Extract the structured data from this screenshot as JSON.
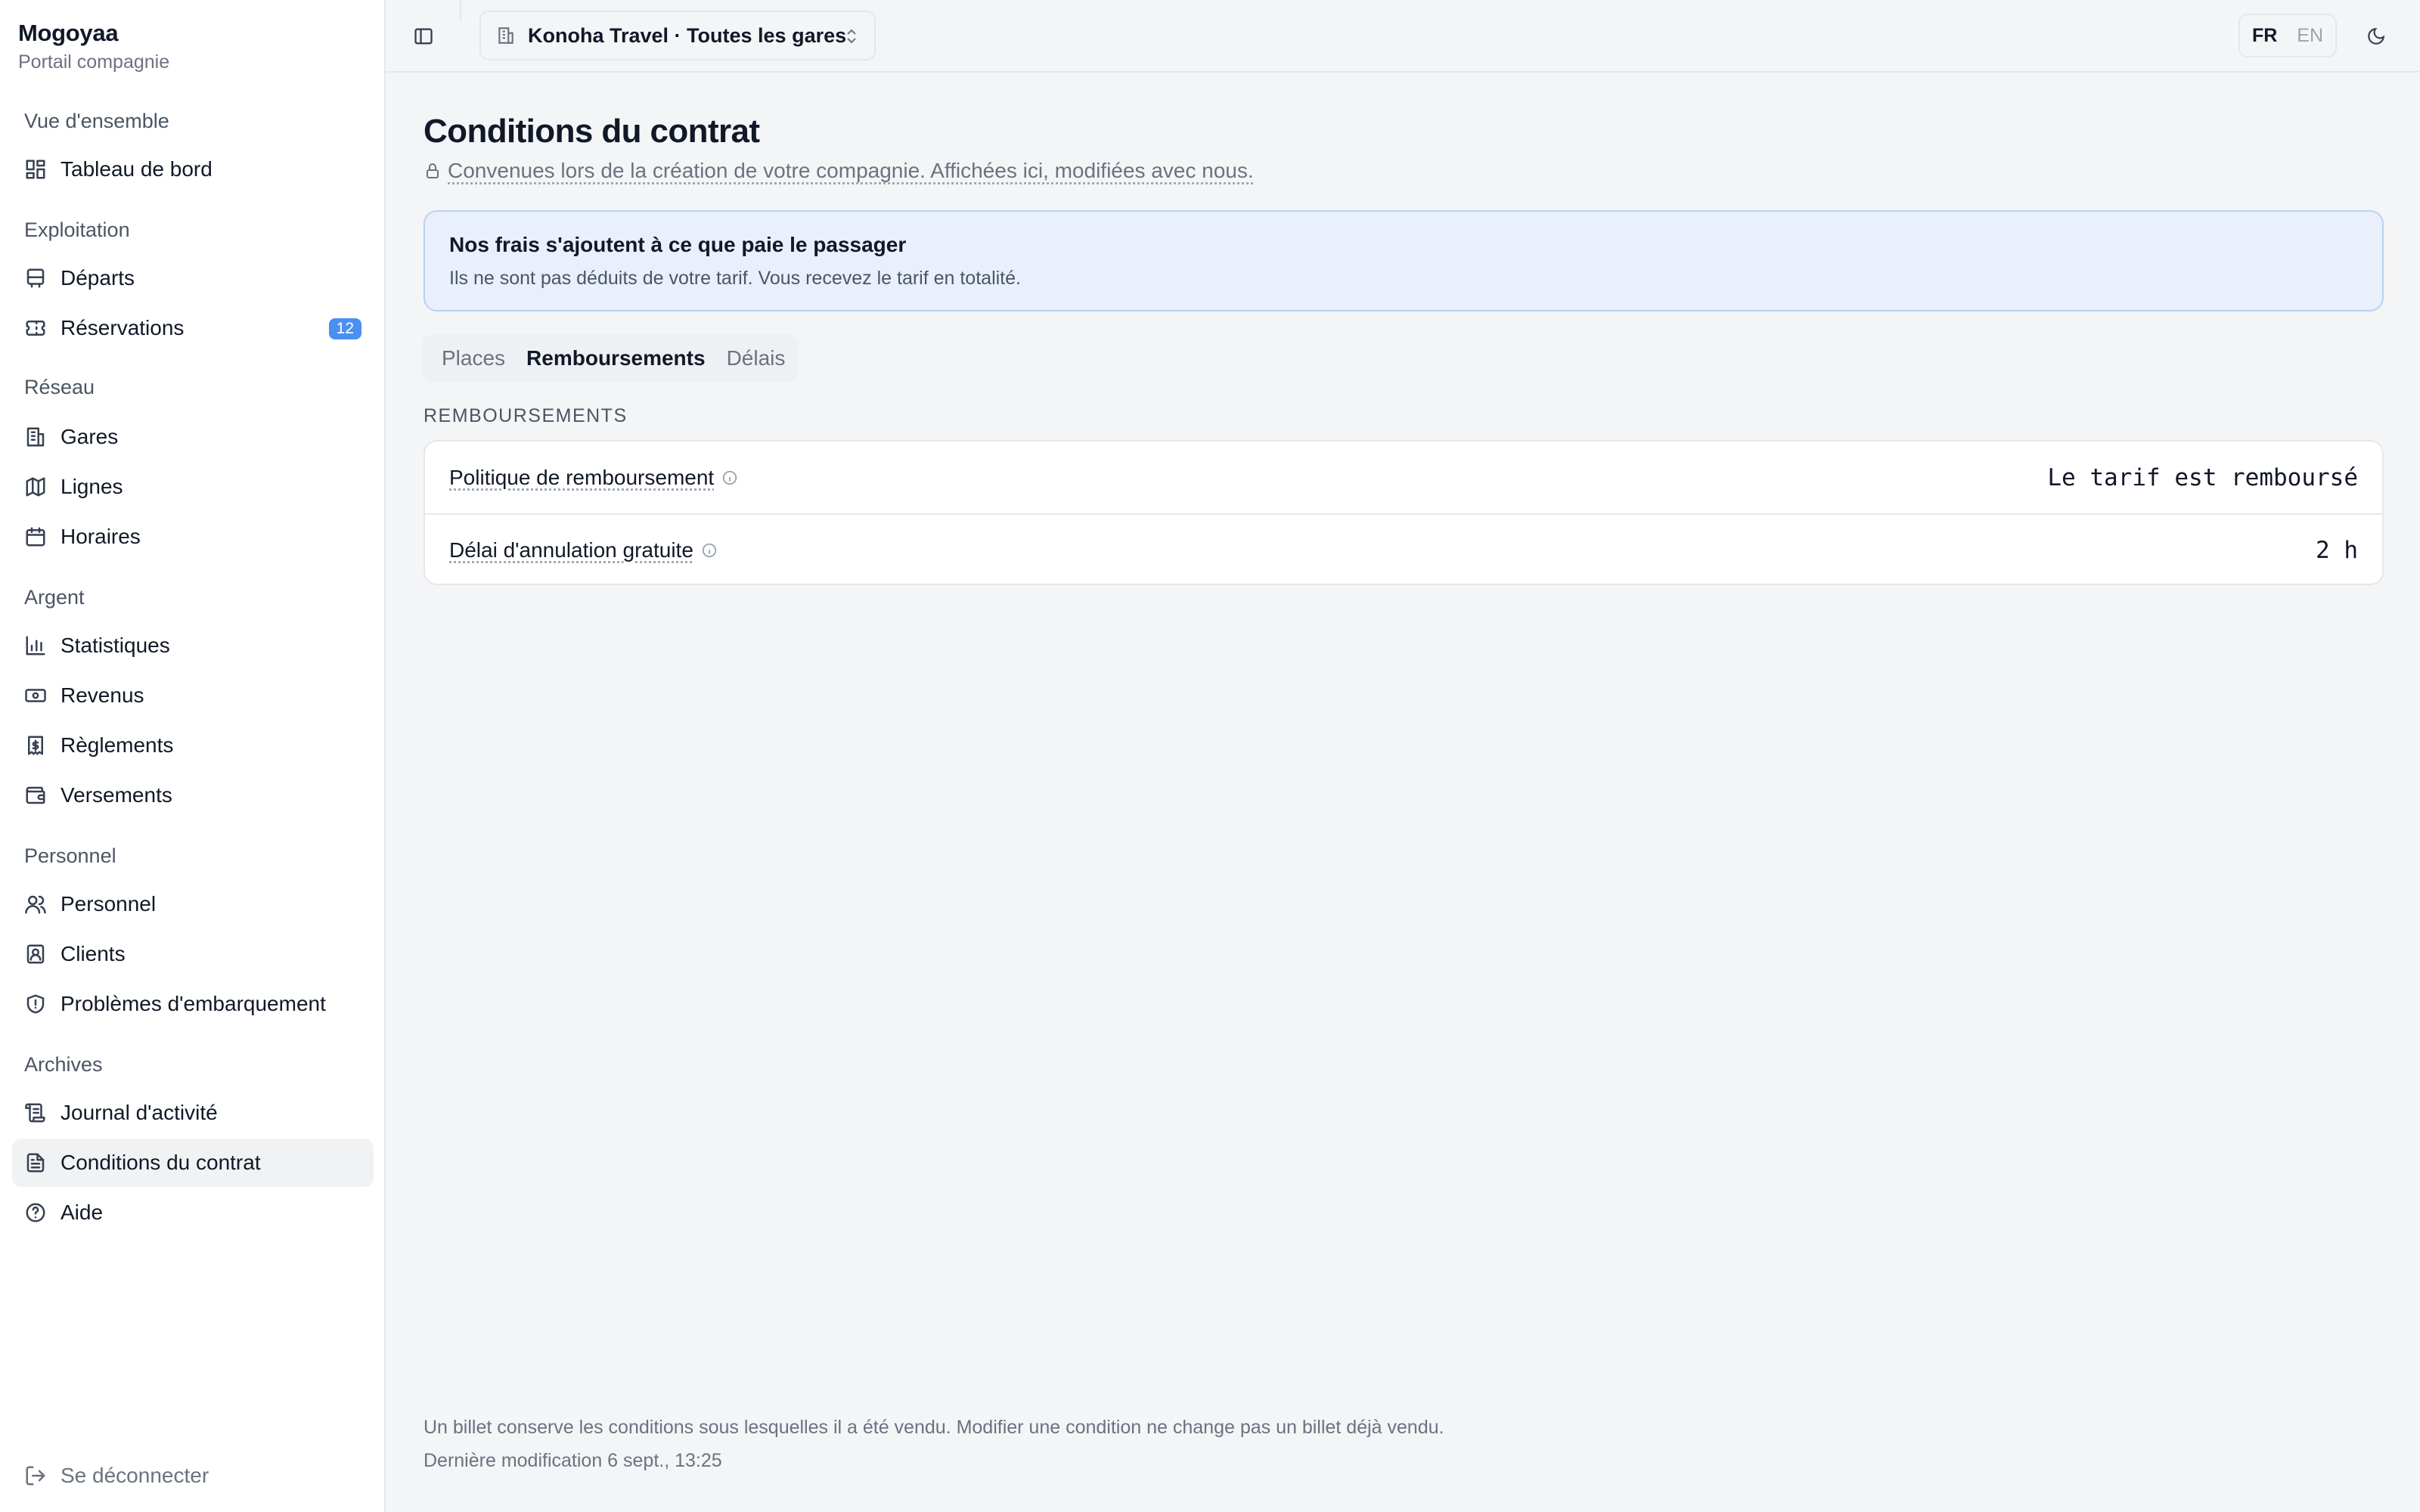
{
  "brand": {
    "name": "Mogoyaa",
    "subtitle": "Portail compagnie"
  },
  "sidebar": {
    "sections": [
      {
        "title": "Vue d'ensemble"
      },
      {
        "title": "Exploitation"
      },
      {
        "title": "Réseau"
      },
      {
        "title": "Argent"
      },
      {
        "title": "Personnel"
      },
      {
        "title": "Archives"
      }
    ],
    "items": [
      {
        "label": "Tableau de bord",
        "icon": "dashboard-icon"
      },
      {
        "label": "Départs",
        "icon": "bus-icon"
      },
      {
        "label": "Réservations",
        "icon": "ticket-icon",
        "badge": "12"
      },
      {
        "label": "Gares",
        "icon": "building-icon"
      },
      {
        "label": "Lignes",
        "icon": "map-icon"
      },
      {
        "label": "Horaires",
        "icon": "calendar-icon"
      },
      {
        "label": "Statistiques",
        "icon": "bar-chart-icon"
      },
      {
        "label": "Revenus",
        "icon": "banknote-icon"
      },
      {
        "label": "Règlements",
        "icon": "receipt-icon"
      },
      {
        "label": "Versements",
        "icon": "wallet-icon"
      },
      {
        "label": "Personnel",
        "icon": "users-icon"
      },
      {
        "label": "Clients",
        "icon": "contact-icon"
      },
      {
        "label": "Problèmes d'embarquement",
        "icon": "shield-alert-icon"
      },
      {
        "label": "Journal d'activité",
        "icon": "scroll-icon"
      },
      {
        "label": "Conditions du contrat",
        "icon": "file-text-icon",
        "active": true
      },
      {
        "label": "Aide",
        "icon": "help-circle-icon"
      }
    ],
    "logout": "Se déconnecter"
  },
  "topbar": {
    "company": "Konoha Travel · Toutes les gares",
    "lang_active": "FR",
    "lang_other": "EN"
  },
  "main": {
    "title": "Conditions du contrat",
    "subtitle": "Convenues lors de la création de votre compagnie. Affichées ici, modifiées avec nous.",
    "info_title": "Nos frais s'ajoutent à ce que paie le passager",
    "info_text": "Ils ne sont pas déduits de votre tarif. Vous recevez le tarif en totalité.",
    "tabs": [
      {
        "label": "Places"
      },
      {
        "label": "Remboursements",
        "active": true
      },
      {
        "label": "Délais"
      }
    ],
    "section_label": "REMBOURSEMENTS",
    "rows": [
      {
        "label": "Politique de remboursement",
        "value": "Le tarif est remboursé"
      },
      {
        "label": "Délai d'annulation gratuite",
        "value": "2 h"
      }
    ],
    "footer_note": "Un billet conserve les conditions sous lesquelles il a été vendu. Modifier une condition ne change pas un billet déjà vendu.",
    "footer_date": "Dernière modification 6 sept., 13:25"
  },
  "colors": {
    "accent": "#4a90f0",
    "info_bg": "#e9f0fb",
    "info_border": "#b9d2f2"
  }
}
